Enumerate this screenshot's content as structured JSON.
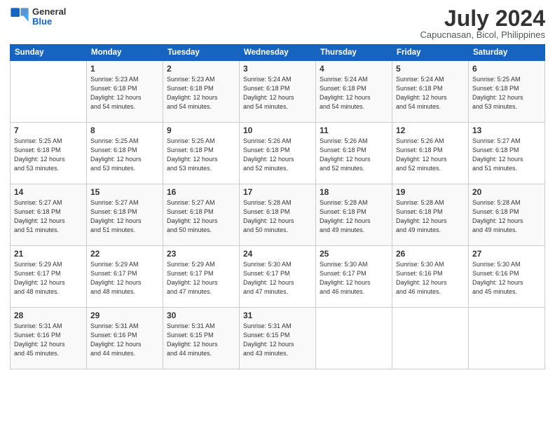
{
  "header": {
    "logo_general": "General",
    "logo_blue": "Blue",
    "month_year": "July 2024",
    "location": "Capucnasan, Bicol, Philippines"
  },
  "weekdays": [
    "Sunday",
    "Monday",
    "Tuesday",
    "Wednesday",
    "Thursday",
    "Friday",
    "Saturday"
  ],
  "weeks": [
    [
      {
        "day": "",
        "text": ""
      },
      {
        "day": "1",
        "text": "Sunrise: 5:23 AM\nSunset: 6:18 PM\nDaylight: 12 hours\nand 54 minutes."
      },
      {
        "day": "2",
        "text": "Sunrise: 5:23 AM\nSunset: 6:18 PM\nDaylight: 12 hours\nand 54 minutes."
      },
      {
        "day": "3",
        "text": "Sunrise: 5:24 AM\nSunset: 6:18 PM\nDaylight: 12 hours\nand 54 minutes."
      },
      {
        "day": "4",
        "text": "Sunrise: 5:24 AM\nSunset: 6:18 PM\nDaylight: 12 hours\nand 54 minutes."
      },
      {
        "day": "5",
        "text": "Sunrise: 5:24 AM\nSunset: 6:18 PM\nDaylight: 12 hours\nand 54 minutes."
      },
      {
        "day": "6",
        "text": "Sunrise: 5:25 AM\nSunset: 6:18 PM\nDaylight: 12 hours\nand 53 minutes."
      }
    ],
    [
      {
        "day": "7",
        "text": "Sunrise: 5:25 AM\nSunset: 6:18 PM\nDaylight: 12 hours\nand 53 minutes."
      },
      {
        "day": "8",
        "text": "Sunrise: 5:25 AM\nSunset: 6:18 PM\nDaylight: 12 hours\nand 53 minutes."
      },
      {
        "day": "9",
        "text": "Sunrise: 5:25 AM\nSunset: 6:18 PM\nDaylight: 12 hours\nand 53 minutes."
      },
      {
        "day": "10",
        "text": "Sunrise: 5:26 AM\nSunset: 6:18 PM\nDaylight: 12 hours\nand 52 minutes."
      },
      {
        "day": "11",
        "text": "Sunrise: 5:26 AM\nSunset: 6:18 PM\nDaylight: 12 hours\nand 52 minutes."
      },
      {
        "day": "12",
        "text": "Sunrise: 5:26 AM\nSunset: 6:18 PM\nDaylight: 12 hours\nand 52 minutes."
      },
      {
        "day": "13",
        "text": "Sunrise: 5:27 AM\nSunset: 6:18 PM\nDaylight: 12 hours\nand 51 minutes."
      }
    ],
    [
      {
        "day": "14",
        "text": "Sunrise: 5:27 AM\nSunset: 6:18 PM\nDaylight: 12 hours\nand 51 minutes."
      },
      {
        "day": "15",
        "text": "Sunrise: 5:27 AM\nSunset: 6:18 PM\nDaylight: 12 hours\nand 51 minutes."
      },
      {
        "day": "16",
        "text": "Sunrise: 5:27 AM\nSunset: 6:18 PM\nDaylight: 12 hours\nand 50 minutes."
      },
      {
        "day": "17",
        "text": "Sunrise: 5:28 AM\nSunset: 6:18 PM\nDaylight: 12 hours\nand 50 minutes."
      },
      {
        "day": "18",
        "text": "Sunrise: 5:28 AM\nSunset: 6:18 PM\nDaylight: 12 hours\nand 49 minutes."
      },
      {
        "day": "19",
        "text": "Sunrise: 5:28 AM\nSunset: 6:18 PM\nDaylight: 12 hours\nand 49 minutes."
      },
      {
        "day": "20",
        "text": "Sunrise: 5:28 AM\nSunset: 6:18 PM\nDaylight: 12 hours\nand 49 minutes."
      }
    ],
    [
      {
        "day": "21",
        "text": "Sunrise: 5:29 AM\nSunset: 6:17 PM\nDaylight: 12 hours\nand 48 minutes."
      },
      {
        "day": "22",
        "text": "Sunrise: 5:29 AM\nSunset: 6:17 PM\nDaylight: 12 hours\nand 48 minutes."
      },
      {
        "day": "23",
        "text": "Sunrise: 5:29 AM\nSunset: 6:17 PM\nDaylight: 12 hours\nand 47 minutes."
      },
      {
        "day": "24",
        "text": "Sunrise: 5:30 AM\nSunset: 6:17 PM\nDaylight: 12 hours\nand 47 minutes."
      },
      {
        "day": "25",
        "text": "Sunrise: 5:30 AM\nSunset: 6:17 PM\nDaylight: 12 hours\nand 46 minutes."
      },
      {
        "day": "26",
        "text": "Sunrise: 5:30 AM\nSunset: 6:16 PM\nDaylight: 12 hours\nand 46 minutes."
      },
      {
        "day": "27",
        "text": "Sunrise: 5:30 AM\nSunset: 6:16 PM\nDaylight: 12 hours\nand 45 minutes."
      }
    ],
    [
      {
        "day": "28",
        "text": "Sunrise: 5:31 AM\nSunset: 6:16 PM\nDaylight: 12 hours\nand 45 minutes."
      },
      {
        "day": "29",
        "text": "Sunrise: 5:31 AM\nSunset: 6:16 PM\nDaylight: 12 hours\nand 44 minutes."
      },
      {
        "day": "30",
        "text": "Sunrise: 5:31 AM\nSunset: 6:15 PM\nDaylight: 12 hours\nand 44 minutes."
      },
      {
        "day": "31",
        "text": "Sunrise: 5:31 AM\nSunset: 6:15 PM\nDaylight: 12 hours\nand 43 minutes."
      },
      {
        "day": "",
        "text": ""
      },
      {
        "day": "",
        "text": ""
      },
      {
        "day": "",
        "text": ""
      }
    ]
  ]
}
